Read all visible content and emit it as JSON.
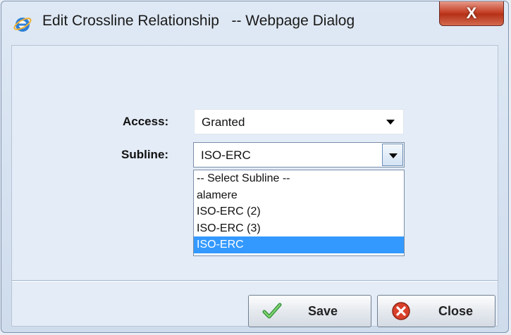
{
  "window": {
    "title": "Edit Crossline Relationship   -- Webpage Dialog",
    "close_glyph": "X"
  },
  "form": {
    "access": {
      "label": "Access:",
      "value": "Granted"
    },
    "subline": {
      "label": "Subline:",
      "value": "ISO-ERC",
      "options": [
        "-- Select Subline --",
        "alamere",
        "ISO-ERC (2)",
        "ISO-ERC (3)",
        "ISO-ERC"
      ],
      "highlighted_option": "ISO-ERC"
    }
  },
  "buttons": {
    "save_label": "Save",
    "close_label": "Close"
  },
  "icons": {
    "title": "ie-icon",
    "save": "checkmark-icon",
    "close": "close-circle-icon"
  },
  "colors": {
    "highlight": "#3399ff",
    "close_button": "#c7442b",
    "save_check": "#4caf50"
  }
}
